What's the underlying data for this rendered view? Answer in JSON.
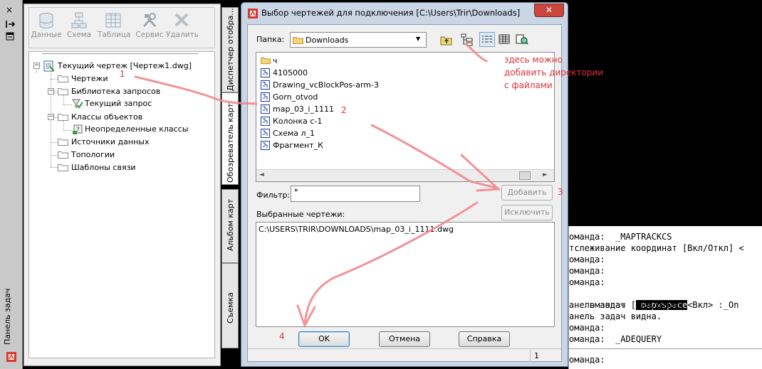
{
  "task_pane": {
    "label": "Панель задач",
    "close_glyph": "×",
    "toolbar": [
      {
        "label": "Данные",
        "icon": "database-icon"
      },
      {
        "label": "Схема",
        "icon": "schema-icon"
      },
      {
        "label": "Таблица",
        "icon": "table-icon"
      },
      {
        "label": "Сервис",
        "icon": "tools-icon"
      },
      {
        "label": "Удалить",
        "icon": "delete-icon"
      }
    ],
    "tree": {
      "root": "Текущий чертеж [Чертеж1.dwg]",
      "drawings": "Чертежи",
      "query_library": "Библиотека запросов",
      "current_query": "Текущий запрос",
      "object_classes": "Классы объектов",
      "undefined_classes": "Неопределенные классы",
      "data_sources": "Источники данных",
      "topologies": "Топологии",
      "link_templates": "Шаблоны связи"
    },
    "tabs": {
      "map_manager": "Диспетчер отобра...",
      "map_explorer": "Обозреватель карт",
      "map_album": "Альбом карт",
      "survey": "Съемка"
    }
  },
  "dialog": {
    "title": "Выбор чертежей для подключения [C:\\Users\\Trir\\Downloads]",
    "close_glyph": "✕",
    "folder_label": "Папка:",
    "folder_value": "Downloads",
    "files": [
      {
        "name": "ч",
        "type": "folder"
      },
      {
        "name": "4105000",
        "type": "dwg"
      },
      {
        "name": "Drawing_vcBlockPos-arm-3",
        "type": "dwg"
      },
      {
        "name": "Gorn_otvod",
        "type": "dwg"
      },
      {
        "name": "map_03_i_1111",
        "type": "dwg"
      },
      {
        "name": "Колонка с-1",
        "type": "dwg"
      },
      {
        "name": "Схема л_1",
        "type": "dwg"
      },
      {
        "name": "Фрагмент_К",
        "type": "dwg"
      }
    ],
    "filter_label": "Фильтр:",
    "filter_value": "*",
    "add_button": "Добавить",
    "exclude_button": "Исключить",
    "selected_label": "Выбранные чертежи:",
    "selected": [
      "C:\\USERS\\TRIR\\DOWNLOADS\\map_03_i_1111.dwg"
    ],
    "ok_button": "OK",
    "cancel_button": "Отмена",
    "help_button": "Справка",
    "status_value": "1"
  },
  "command_line": [
    {
      "text": "оманда:  _MAPTRACKCS"
    },
    {
      "text": "тслеживание координат [Вкл/Откл] <"
    },
    {
      "text": "оманда:"
    },
    {
      "text": "оманда:"
    },
    {
      "text": "оманда:"
    },
    {
      "text": "оманда:",
      "highlight": " mapwspace"
    },
    {
      "text": "анель задач [Вкл/Откл] <Вкл> :_On"
    },
    {
      "text": "анель задач видна."
    },
    {
      "text": "оманда:"
    },
    {
      "text": "оманда:  _ADEQUERY"
    },
    {
      "text": ""
    },
    {
      "text": "оманда:"
    }
  ],
  "annotations": {
    "step1": "1",
    "step2": "2",
    "step3": "3",
    "step4": "4",
    "note_line1": "здесь можно",
    "note_line2": "добавить директории",
    "note_line3": "с файлами"
  },
  "colors": {
    "annotation": "#e0313a",
    "close_button": "#c9463d",
    "dialog_frame": "#c9d6e6"
  }
}
